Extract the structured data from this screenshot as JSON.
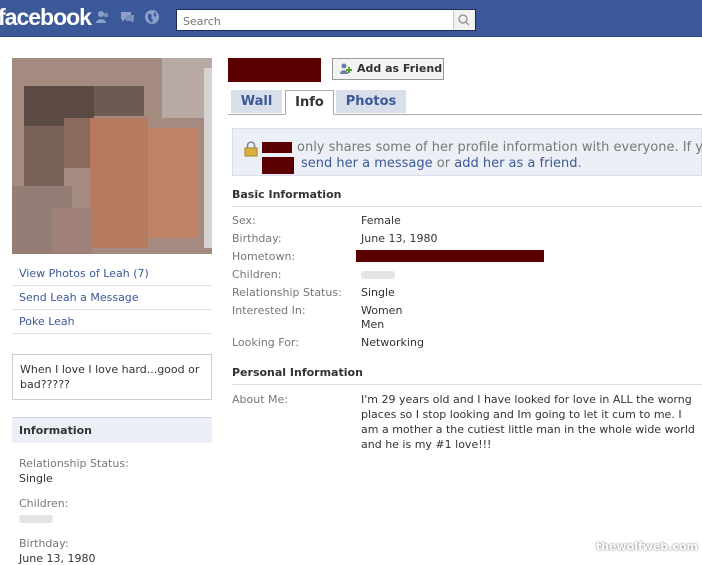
{
  "topbar": {
    "logo": "facebook",
    "search_placeholder": "Search",
    "icons": [
      "friends-icon",
      "messages-icon",
      "notifications-globe-icon",
      "search-icon"
    ]
  },
  "left": {
    "links": [
      "View Photos of Leah (7)",
      "Send Leah a Message",
      "Poke Leah"
    ],
    "status": "When I love I love hard...good or bad?????",
    "info_title": "Information",
    "fields": [
      {
        "label": "Relationship Status:",
        "value": "Single"
      },
      {
        "label": "Children:",
        "value": ""
      },
      {
        "label": "Birthday:",
        "value": "June 13, 1980"
      }
    ]
  },
  "profile": {
    "add_friend_label": "Add as Friend",
    "tabs": [
      "Wall",
      "Info",
      "Photos"
    ],
    "active_tab": "Info",
    "notice_text": "only shares some of her profile information with everyone. If you",
    "notice_link_message": "send her a message",
    "notice_or": "or",
    "notice_link_friend": "add her as a friend",
    "notice_end": "."
  },
  "basic_info": {
    "title": "Basic Information",
    "rows": [
      {
        "label": "Sex:",
        "value": "Female"
      },
      {
        "label": "Birthday:",
        "value": "June 13, 1980"
      },
      {
        "label": "Hometown:",
        "value": ""
      },
      {
        "label": "Children:",
        "value": ""
      },
      {
        "label": "Relationship Status:",
        "value": "Single"
      },
      {
        "label": "Interested In:",
        "value": "Women"
      },
      {
        "label": "",
        "value": "Men"
      },
      {
        "label": "Looking For:",
        "value": "Networking"
      }
    ]
  },
  "personal_info": {
    "title": "Personal Information",
    "about_label": "About Me:",
    "about_text": "I'm 29 years old and I have looked for love in ALL the worng places so I stop looking and Im going to let it cum to me. I am a mother a the cutiest little man in the whole wide world and he is my #1 love!!!"
  },
  "watermark": "thewolfweb.com",
  "colors": {
    "brand": "#3b5998",
    "redaction": "#5a0000",
    "link": "#3b5998"
  }
}
